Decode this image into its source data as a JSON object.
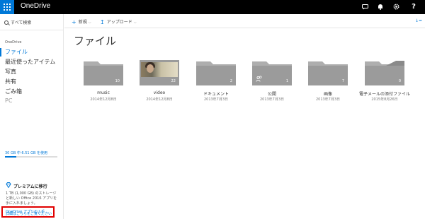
{
  "topbar": {
    "app_title": "OneDrive",
    "icons": [
      "chat-icon",
      "bell-icon",
      "gear-icon",
      "help-icon"
    ],
    "accent": "#0078d7",
    "background": "#000000"
  },
  "search": {
    "label": "すべて検索"
  },
  "sidebar": {
    "heading": "OneDrive",
    "items": [
      {
        "label": "ファイル"
      },
      {
        "label": "最近使ったアイテム"
      },
      {
        "label": "写真"
      },
      {
        "label": "共有"
      },
      {
        "label": "ごみ箱"
      },
      {
        "label": "PC"
      }
    ],
    "storage_text": "30 GB 中 6.51 GB を使用",
    "storage_used_fraction": 0.217,
    "premium": {
      "title": "プレミアムに移行",
      "text": "1 TB (1,000 GB) のストレージと新しい Office 2016 アプリを手に入れましょう。",
      "link": "詳細はこちらをご覧ください"
    },
    "get_app": "OneDrive アプリの入手",
    "highlight_color": "#e00000"
  },
  "commands": {
    "new": "新規",
    "upload": "アップロード",
    "right_glyph": "↓="
  },
  "main": {
    "title": "ファイル",
    "folders": [
      {
        "name": "music",
        "date": "2014年12月8日",
        "count": "10"
      },
      {
        "name": "video",
        "date": "2014年12月8日",
        "count": "22"
      },
      {
        "name": "ドキュメント",
        "date": "2013年7月3日",
        "count": "2"
      },
      {
        "name": "公開",
        "date": "2013年7月3日",
        "count": "1"
      },
      {
        "name": "画像",
        "date": "2013年7月3日",
        "count": "7"
      },
      {
        "name": "電子メールの添付ファイル",
        "date": "2015年8月26日",
        "count": "0"
      }
    ]
  }
}
